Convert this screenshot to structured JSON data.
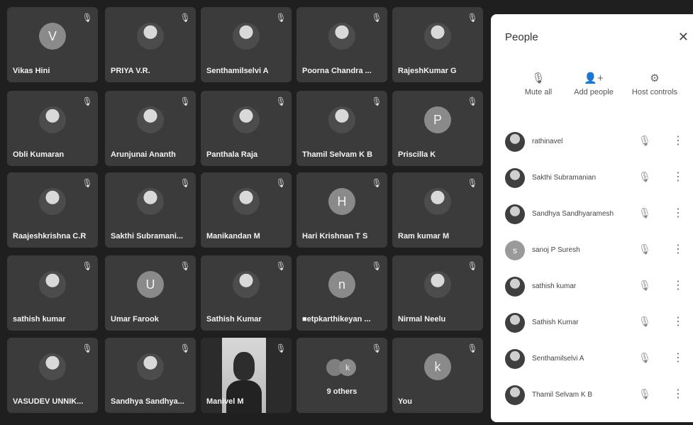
{
  "tiles": [
    {
      "name": "Vikas Hini",
      "avatar": "V",
      "type": "letter"
    },
    {
      "name": "PRIYA V.R.",
      "avatar": "",
      "type": "photo"
    },
    {
      "name": "Senthamilselvi A",
      "avatar": "",
      "type": "photo"
    },
    {
      "name": "Poorna Chandra ...",
      "avatar": "",
      "type": "photo"
    },
    {
      "name": "RajeshKumar G",
      "avatar": "",
      "type": "photo"
    },
    {
      "name": "Obli Kumaran",
      "avatar": "",
      "type": "photo"
    },
    {
      "name": "Arunjunai Ananth",
      "avatar": "",
      "type": "photo"
    },
    {
      "name": "Panthala Raja",
      "avatar": "",
      "type": "photo"
    },
    {
      "name": "Thamil Selvam K B",
      "avatar": "",
      "type": "photo"
    },
    {
      "name": "Priscilla K",
      "avatar": "P",
      "type": "letter"
    },
    {
      "name": "Raajeshkrishna C.R",
      "avatar": "",
      "type": "photo"
    },
    {
      "name": "Sakthi Subramani...",
      "avatar": "",
      "type": "photo"
    },
    {
      "name": "Manikandan M",
      "avatar": "",
      "type": "photo"
    },
    {
      "name": "Hari Krishnan T S",
      "avatar": "H",
      "type": "letter"
    },
    {
      "name": "Ram kumar M",
      "avatar": "",
      "type": "photo"
    },
    {
      "name": "sathish kumar",
      "avatar": "",
      "type": "photo"
    },
    {
      "name": "Umar Farook",
      "avatar": "U",
      "type": "letter"
    },
    {
      "name": "Sathish Kumar",
      "avatar": "",
      "type": "photo"
    },
    {
      "name": "■etpkarthikeyan ...",
      "avatar": "n",
      "type": "letter"
    },
    {
      "name": "Nirmal Neelu",
      "avatar": "",
      "type": "photo"
    },
    {
      "name": "VASUDEV UNNIK...",
      "avatar": "",
      "type": "photo"
    },
    {
      "name": "Sandhya Sandhya...",
      "avatar": "",
      "type": "photo"
    },
    {
      "name": "Manivel M",
      "avatar": "",
      "type": "video"
    },
    {
      "name": "9 others",
      "avatar": "k",
      "type": "others"
    },
    {
      "name": "You",
      "avatar": "k",
      "type": "letter"
    }
  ],
  "panel": {
    "title": "People",
    "close_icon": "close-icon",
    "actions": [
      {
        "label": "Mute all",
        "icon": "mute-all-icon"
      },
      {
        "label": "Add people",
        "icon": "add-people-icon"
      },
      {
        "label": "Host controls",
        "icon": "host-controls-icon"
      }
    ],
    "participants": [
      {
        "name": "rathinavel",
        "avatar": "",
        "type": "photo"
      },
      {
        "name": "Sakthi Subramanian",
        "avatar": "",
        "type": "photo"
      },
      {
        "name": "Sandhya Sandhyaramesh",
        "avatar": "",
        "type": "photo"
      },
      {
        "name": "sanoj P Suresh",
        "avatar": "s",
        "type": "letter"
      },
      {
        "name": "sathish kumar",
        "avatar": "",
        "type": "photo"
      },
      {
        "name": "Sathish Kumar",
        "avatar": "",
        "type": "photo"
      },
      {
        "name": "Senthamilselvi A",
        "avatar": "",
        "type": "photo"
      },
      {
        "name": "Thamil Selvam K B",
        "avatar": "",
        "type": "photo"
      }
    ]
  }
}
